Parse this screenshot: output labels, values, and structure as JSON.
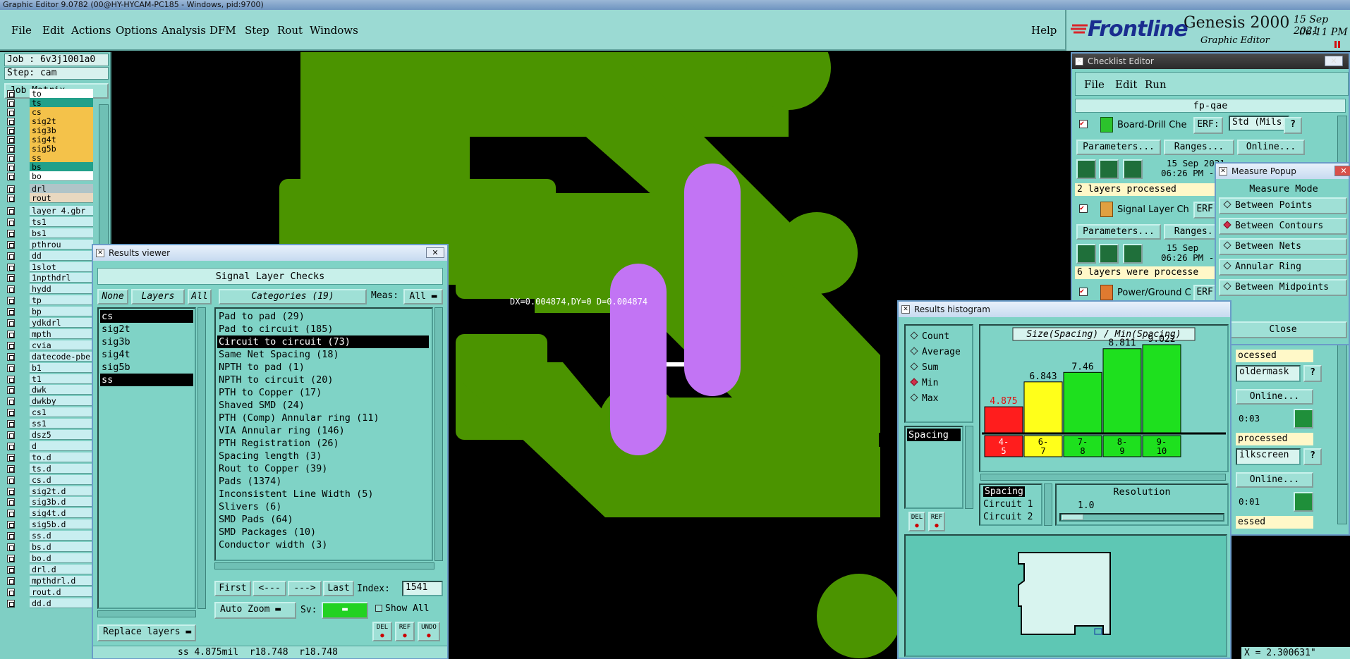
{
  "window_title": "Graphic Editor 9.0782 (00@HY-HYCAM-PC185 - Windows, pid:9700)",
  "menu": [
    "File",
    "Edit",
    "Actions",
    "Options",
    "Analysis",
    "DFM",
    "Step",
    "Rout",
    "Windows"
  ],
  "help_label": "Help",
  "brand": {
    "logo": "Frontline",
    "product": "Genesis 2000",
    "subtitle": "Graphic Editor",
    "date": "15 Sep 2021",
    "time": "06:11 PM"
  },
  "job": {
    "job": "Job : 6v3j1001a0",
    "step": "Step: cam",
    "matrix_btn": "Job Matrix ..."
  },
  "layers_top": [
    {
      "name": "to",
      "color": "#ffffff"
    },
    {
      "name": "ts",
      "color": "#22a08a"
    },
    {
      "name": "cs",
      "color": "#f4c24a"
    },
    {
      "name": "sig2t",
      "color": "#f4c24a"
    },
    {
      "name": "sig3b",
      "color": "#f4c24a"
    },
    {
      "name": "sig4t",
      "color": "#f4c24a"
    },
    {
      "name": "sig5b",
      "color": "#f4c24a"
    },
    {
      "name": "ss",
      "color": "#f4c24a"
    },
    {
      "name": "bs",
      "color": "#22a08a"
    },
    {
      "name": "bo",
      "color": "#ffffff"
    }
  ],
  "layers_drill": [
    {
      "name": "drl",
      "color": "#b0c4c8"
    },
    {
      "name": "rout",
      "color": "#e8d8c0"
    }
  ],
  "layers_misc": [
    "layer_4.gbr",
    "ts1",
    "bs1",
    "pthrou",
    "dd",
    "1slot",
    "1npthdrl",
    "hydd",
    "tp",
    "bp",
    "ydkdrl",
    "mpth",
    "cvia",
    "datecode-pbe",
    "b1",
    "t1",
    "dwk",
    "dwkby",
    "cs1",
    "ss1",
    "dsz5",
    "d",
    "to.d",
    "ts.d",
    "cs.d",
    "sig2t.d",
    "sig3b.d",
    "sig4t.d",
    "sig5b.d",
    "ss.d",
    "bs.d",
    "bo.d",
    "drl.d",
    "mpthdrl.d",
    "rout.d",
    "dd.d"
  ],
  "canvas": {
    "measure_text": "DX=0.004874,DY=0 D=0.004874"
  },
  "results_viewer": {
    "title": "Results viewer",
    "header": "Signal Layer Checks",
    "none_btn": "None",
    "layers_btn": "Layers",
    "all_btn": "All",
    "categories_btn": "Categories (19)",
    "meas_label": "Meas:",
    "meas_value": "All",
    "layers": [
      "cs",
      "sig2t",
      "sig3b",
      "sig4t",
      "sig5b",
      "ss"
    ],
    "categories": [
      "Pad to pad (29)",
      "Pad to circuit (185)",
      "Circuit to circuit (73)",
      "Same Net Spacing (18)",
      "NPTH to pad (1)",
      "NPTH to circuit (20)",
      "PTH to Copper (17)",
      "Shaved SMD (24)",
      "PTH (Comp) Annular ring (11)",
      "VIA Annular ring (146)",
      "PTH Registration (26)",
      "Spacing length (3)",
      "Rout to Copper (39)",
      "Pads (1374)",
      "Inconsistent Line Width (5)",
      "Slivers (6)",
      "SMD Pads (64)",
      "SMD Packages (10)",
      "Conductor width (3)"
    ],
    "first": "First",
    "prev": "<---",
    "next": "--->",
    "last": "Last",
    "index_label": "Index:",
    "index_value": "1541",
    "auto_zoom": "Auto Zoom",
    "sv_label": "Sv:",
    "show_all": "Show All",
    "replace_layers": "Replace layers",
    "del": "DEL",
    "ref": "REF",
    "undo": "UNDO",
    "status": "ss 4.875mil  r18.748  r18.748"
  },
  "checklist": {
    "title": "Checklist Editor",
    "menu": [
      "File",
      "Edit",
      "Run"
    ],
    "name": "fp-qae",
    "board_drill": "Board-Drill Che",
    "erf": "ERF:",
    "std_mils": "Std (Mils)",
    "parameters": "Parameters...",
    "ranges": "Ranges...",
    "online": "Online...",
    "date1": "15 Sep 2021",
    "time1": "06:26 PM -",
    "processed1": "2 layers processed",
    "signal_layer": "Signal Layer Ch",
    "date2": "15 Sep",
    "time2": "06:26 PM -",
    "processed2": "6 layers were processe",
    "power_ground": "Power/Ground C",
    "frag": [
      "ocessed",
      "oldermask",
      "Online...",
      "0:03",
      "processed",
      "ilkscreen",
      "Online...",
      "0:01",
      "essed"
    ]
  },
  "measure_popup": {
    "title": "Measure Popup",
    "mode_header": "Measure Mode",
    "options": [
      "Between Points",
      "Between Contours",
      "Between Nets",
      "Annular Ring",
      "Between Midpoints"
    ],
    "selected": 1,
    "close": "Close"
  },
  "histogram": {
    "title": "Results histogram",
    "options": [
      "Count",
      "Average",
      "Sum",
      "Min",
      "Max"
    ],
    "selected": 3,
    "list_item": "Spacing",
    "chart_title": "Size(Spacing) / Min(Spacing)",
    "bars": [
      {
        "value": 4.875,
        "label": "4.875",
        "range": "4-\n5",
        "color": "#ff1d1d"
      },
      {
        "value": 6.843,
        "label": "6.843",
        "range": "6-\n7",
        "color": "#ffff1a"
      },
      {
        "value": 7.46,
        "label": "7.46",
        "range": "7-\n8",
        "color": "#1ee01e"
      },
      {
        "value": 8.811,
        "label": "8.811",
        "range": "8-\n9",
        "color": "#1ee01e"
      },
      {
        "value": 9.022,
        "label": "9.022",
        "range": "9-\n10",
        "color": "#1ee01e"
      }
    ],
    "legend": [
      "Spacing",
      "Circuit 1",
      "Circuit 2"
    ],
    "resolution_label": "Resolution",
    "resolution_value": "1.0",
    "del": "DEL",
    "ref": "REF"
  },
  "coord_readout": "X = 2.300631\""
}
